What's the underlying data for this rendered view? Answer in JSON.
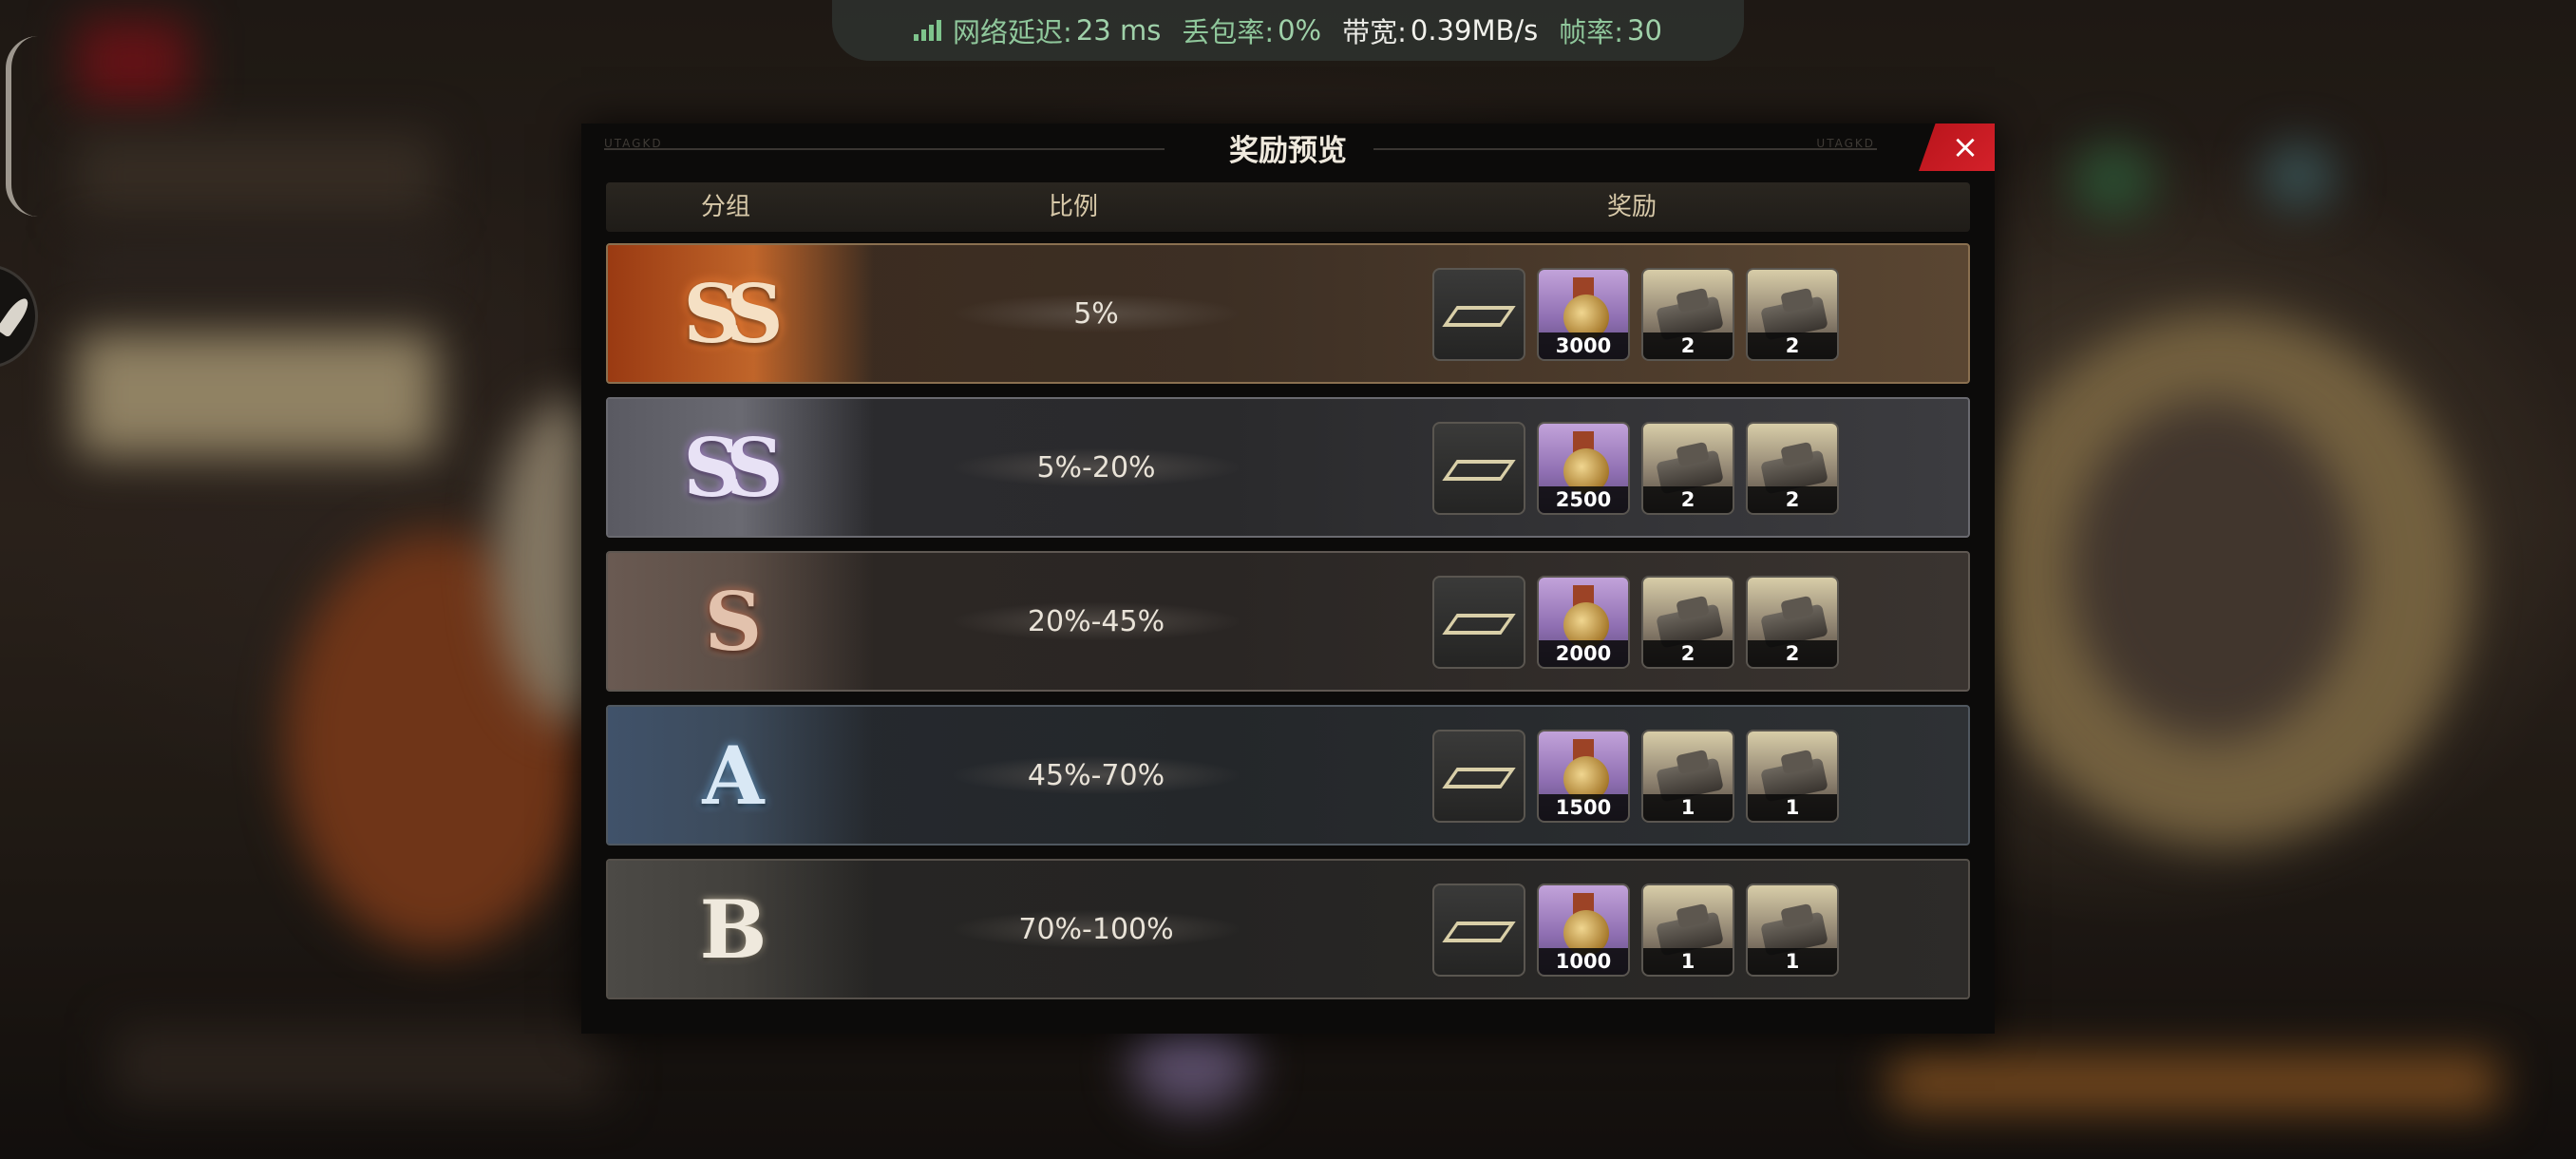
{
  "net": {
    "latency_label": "网络延迟:",
    "latency_value": "23 ms",
    "loss_label": "丢包率:",
    "loss_value": "0%",
    "bandwidth_label": "带宽:",
    "bandwidth_value": "0.39MB/s",
    "fps_label": "帧率:",
    "fps_value": "30"
  },
  "modal": {
    "title": "奖励预览",
    "close_icon": "×",
    "deco_text": "UTAGKD",
    "columns": [
      "分组",
      "比例",
      "奖励"
    ]
  },
  "rows": [
    {
      "rank": "SS",
      "ratio": "5%",
      "rewards": [
        {
          "icon": "frame-icon",
          "qty": ""
        },
        {
          "icon": "gold-coin-icon",
          "qty": "3000"
        },
        {
          "icon": "tank-icon",
          "qty": "2"
        },
        {
          "icon": "tank-icon",
          "qty": "2"
        }
      ]
    },
    {
      "rank": "SS",
      "ratio": "5%-20%",
      "rewards": [
        {
          "icon": "frame-icon",
          "qty": ""
        },
        {
          "icon": "gold-coin-icon",
          "qty": "2500"
        },
        {
          "icon": "tank-icon",
          "qty": "2"
        },
        {
          "icon": "tank-icon",
          "qty": "2"
        }
      ]
    },
    {
      "rank": "S",
      "ratio": "20%-45%",
      "rewards": [
        {
          "icon": "frame-icon",
          "qty": ""
        },
        {
          "icon": "gold-coin-icon",
          "qty": "2000"
        },
        {
          "icon": "tank-icon",
          "qty": "2"
        },
        {
          "icon": "tank-icon",
          "qty": "2"
        }
      ]
    },
    {
      "rank": "A",
      "ratio": "45%-70%",
      "rewards": [
        {
          "icon": "frame-icon",
          "qty": ""
        },
        {
          "icon": "gold-coin-icon",
          "qty": "1500"
        },
        {
          "icon": "tank-icon",
          "qty": "1"
        },
        {
          "icon": "tank-icon",
          "qty": "1"
        }
      ]
    },
    {
      "rank": "B",
      "ratio": "70%-100%",
      "rewards": [
        {
          "icon": "frame-icon",
          "qty": ""
        },
        {
          "icon": "gold-coin-icon",
          "qty": "1000"
        },
        {
          "icon": "tank-icon",
          "qty": "1"
        },
        {
          "icon": "tank-icon",
          "qty": "1"
        }
      ]
    }
  ],
  "colors": {
    "close_red": "#d4212a",
    "net_green": "#8fc79b"
  }
}
